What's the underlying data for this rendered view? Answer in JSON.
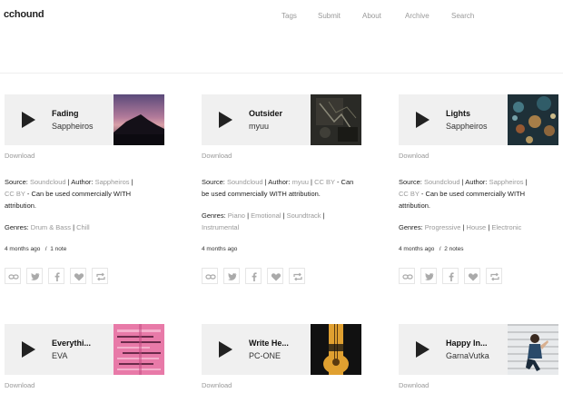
{
  "header": {
    "logo": "cchound",
    "nav": [
      "Tags",
      "Submit",
      "About",
      "Archive",
      "Search"
    ]
  },
  "common": {
    "download": "Download",
    "source_label": "Source:",
    "author_label": "Author:",
    "genres_label": "Genres:",
    "sep": "|",
    "license_text": " - Can be used commercially WITH attribution."
  },
  "cards": [
    {
      "title": "Fading",
      "artist": "Sappheiros",
      "source": "Soundcloud",
      "author": "Sappheiros",
      "license": "CC BY",
      "genres": [
        "Drum & Bass",
        "Chill"
      ],
      "age": "4 months ago",
      "notes": "1 note"
    },
    {
      "title": "Outsider",
      "artist": "myuu",
      "source": "Soundcloud",
      "author": "myuu",
      "license": "CC BY",
      "genres": [
        "Piano",
        "Emotional",
        "Soundtrack",
        "Instrumental"
      ],
      "age": "4 months ago",
      "notes": ""
    },
    {
      "title": "Lights",
      "artist": "Sappheiros",
      "source": "Soundcloud",
      "author": "Sappheiros",
      "license": "CC BY",
      "genres": [
        "Progressive",
        "House",
        "Electronic"
      ],
      "age": "4 months ago",
      "notes": "2 notes"
    },
    {
      "title": "Everythi...",
      "artist": "EVA"
    },
    {
      "title": "Write He...",
      "artist": "PC-ONE",
      "cover_text": "WRITE HER ON YOUR HEART #INSTRUMENTAL"
    },
    {
      "title": "Happy In...",
      "artist": "GarnaVutka"
    }
  ],
  "icons": [
    "link-icon",
    "twitter-icon",
    "facebook-icon",
    "heart-icon",
    "reblog-icon"
  ],
  "colors": {
    "muted": "#999999",
    "player_bg": "#f0f0f0",
    "text": "#222222"
  }
}
